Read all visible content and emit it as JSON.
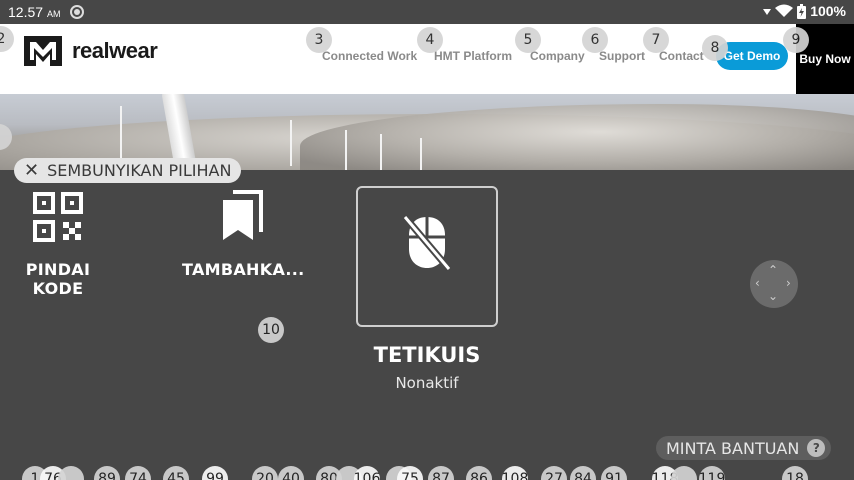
{
  "status_bar": {
    "time": "12.57",
    "ampm": "AM",
    "battery": "100%"
  },
  "site": {
    "logo_text": "realwear",
    "nav": [
      {
        "label": "Connected Work",
        "badge": "3"
      },
      {
        "label": "HMT Platform",
        "badge": "4"
      },
      {
        "label": "Company",
        "badge": "5"
      },
      {
        "label": "Support",
        "badge": "6"
      },
      {
        "label": "Contact",
        "badge": "7"
      }
    ],
    "get_demo": "Get Demo",
    "get_demo_badge": "8",
    "buy_now": "Buy Now",
    "buy_now_badge": "9",
    "logo_badge": "2"
  },
  "overlay": {
    "hide_options": "SEMBUNYIKAN PILIHAN",
    "scan_code": "PINDAI KODE",
    "add_bookmark": "TAMBAHKA...",
    "mouse_title": "TETIKUIS",
    "mouse_status": "Nonaktif",
    "mouse_badge": "10",
    "help": "MINTA BANTUAN",
    "help_q": "?"
  },
  "bottom_badges": [
    "1",
    "76",
    "89",
    "74",
    "45",
    "99",
    "20",
    "40",
    "80",
    "106",
    "75",
    "87",
    "86",
    "108",
    "27",
    "84",
    "91",
    "118",
    "119",
    "18"
  ],
  "colors": {
    "overlay_bg": "#474747",
    "accent_blue": "#0a9bd8",
    "badge_bg": "#d4d4d4"
  }
}
